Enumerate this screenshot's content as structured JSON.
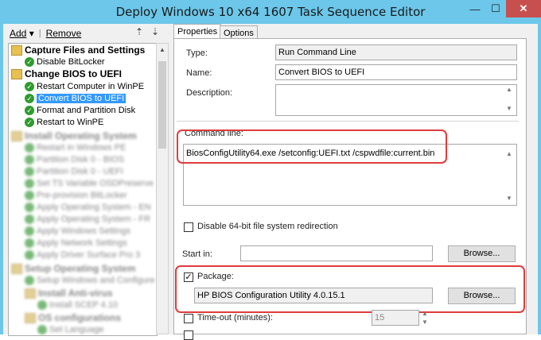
{
  "window": {
    "title": "Deploy Windows 10 x64 1607 Task Sequence Editor",
    "minimize_glyph": "—",
    "maximize_glyph": "☐",
    "close_glyph": "✕"
  },
  "toolbar": {
    "add_label": "Add",
    "add_arrow": "▾",
    "remove_label": "Remove",
    "separator": "|",
    "up_icon_glyph": "⇡",
    "down_icon_glyph": "⇣"
  },
  "tree": {
    "groups": [
      {
        "label": "Capture Files and Settings",
        "items": [
          "Disable BitLocker"
        ]
      },
      {
        "label": "Change BIOS to UEFI",
        "items": [
          "Restart Computer in WinPE",
          "Convert BIOS to UEFI",
          "Format and Partition Disk",
          "Restart  to WinPE"
        ]
      }
    ],
    "selected_item": "Convert BIOS to UEFI",
    "blurred_items": [
      "Install Operating System",
      "Restart in Windows PE",
      "Partition Disk 0 - BIOS",
      "Partition Disk 0 - UEFI",
      "Set TS Variable OSDPreserve",
      "Pre-provision BitLocker",
      "Apply Operating System - EN",
      "Apply Operating System - FR",
      "Apply Windows Settings",
      "Apply Network Settings",
      "Apply Driver Surface Pro 3",
      "Setup Operating System",
      "Setup Windows and Configure",
      "Install Anti-virus",
      "Install SCEP 4.10",
      "OS configurations",
      "Set Language"
    ],
    "check_glyph": "✓",
    "scroll_up": "▲"
  },
  "tabs": [
    {
      "label": "Properties"
    },
    {
      "label": "Options"
    }
  ],
  "properties": {
    "type_label": "Type:",
    "type_value": "Run Command Line",
    "name_label": "Name:",
    "name_value": "Convert BIOS to UEFI",
    "description_label": "Description:",
    "description_value": "",
    "command_line_label": "Command line:",
    "command_line_value": "BiosConfigUtility64.exe /setconfig:UEFI.txt /cspwdfile:current.bin",
    "disable_redirection_label": "Disable 64-bit file system redirection",
    "disable_redirection_checked": false,
    "start_in_label": "Start in:",
    "start_in_value": "",
    "browse_label": "Browse...",
    "package_label": "Package:",
    "package_checked": true,
    "package_value": "HP BIOS Configuration Utility 4.0.15.1",
    "timeout_label": "Time-out (minutes):",
    "timeout_checked": false,
    "timeout_value": "15",
    "check_glyph": "✓",
    "up_arrow": "▲",
    "down_arrow": "▼"
  },
  "colors": {
    "titlebar": "#6cc7ea",
    "close_button": "#c7504f",
    "selection": "#3399ff",
    "highlight_annotation": "#e03c3c",
    "success_check": "#2e9b2e"
  }
}
